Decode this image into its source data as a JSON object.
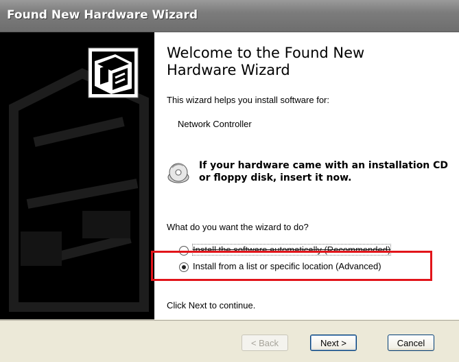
{
  "window": {
    "title": "Found New Hardware Wizard"
  },
  "content": {
    "heading_line1": "Welcome to the Found New",
    "heading_line2": "Hardware Wizard",
    "intro": "This wizard helps you install software for:",
    "device": "Network Controller",
    "cd_line1": "If your hardware came with an installation CD",
    "cd_line2": "or floppy disk, insert it now.",
    "question": "What do you want the wizard to do?",
    "options": [
      {
        "label": "Install the software automatically (Recommended)",
        "selected": false
      },
      {
        "label": "Install from a list or specific location (Advanced)",
        "selected": true
      }
    ],
    "continue": "Click Next to continue."
  },
  "buttons": {
    "back": "< Back",
    "next": "Next >",
    "cancel": "Cancel"
  },
  "icons": {
    "wizard": "hardware-wizard-icon",
    "cd": "cd-disk-icon"
  },
  "colors": {
    "highlight": "#e2141a",
    "side_panel": "#000000",
    "titlebar": "#7c7c7c"
  }
}
